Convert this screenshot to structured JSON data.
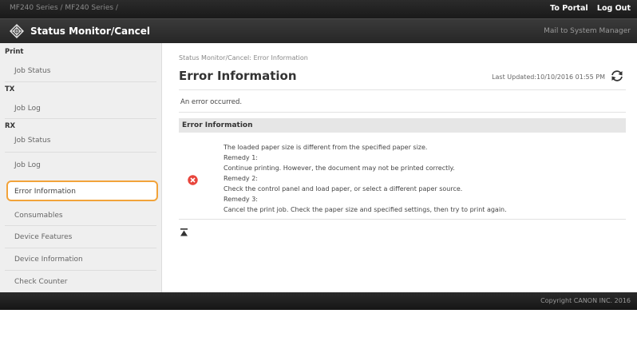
{
  "header": {
    "device_name": "MF240 Series / MF240 Series /",
    "to_portal": "To Portal",
    "log_out": "Log Out"
  },
  "titlebar": {
    "app_title": "Status Monitor/Cancel",
    "mail_link": "Mail to System Manager"
  },
  "sidebar": {
    "print_heading": "Print",
    "print_job_status": "Job Status",
    "tx_heading": "TX",
    "tx_job_log": "Job Log",
    "rx_heading": "RX",
    "rx_job_status": "Job Status",
    "rx_job_log": "Job Log",
    "error_information": "Error Information",
    "consumables": "Consumables",
    "device_features": "Device Features",
    "device_information": "Device Information",
    "check_counter": "Check Counter"
  },
  "main": {
    "breadcrumb": "Status Monitor/Cancel: Error Information",
    "title": "Error Information",
    "last_updated": "Last Updated:10/10/2016 01:55 PM",
    "message": "An error occurred.",
    "section_title": "Error Information",
    "details": [
      "The loaded paper size is different from the specified paper size.",
      "Remedy 1:",
      "Continue printing. However, the document may not be printed correctly.",
      "Remedy 2:",
      "Check the control panel and load paper, or select a different paper source.",
      "Remedy 3:",
      "Cancel the print job. Check the paper size and specified settings, then try to print again."
    ]
  },
  "footer": {
    "copyright": "Copyright CANON INC. 2016"
  },
  "colors": {
    "active_outline": "#f2a33a",
    "error_icon": "#e8453c",
    "bar_dark": "#1f1f1f",
    "sidebar_bg": "#efefef"
  },
  "icons": {
    "logo": "diamond-logo-icon",
    "refresh": "refresh-icon",
    "error": "error-x-icon",
    "page_top": "page-top-icon"
  }
}
